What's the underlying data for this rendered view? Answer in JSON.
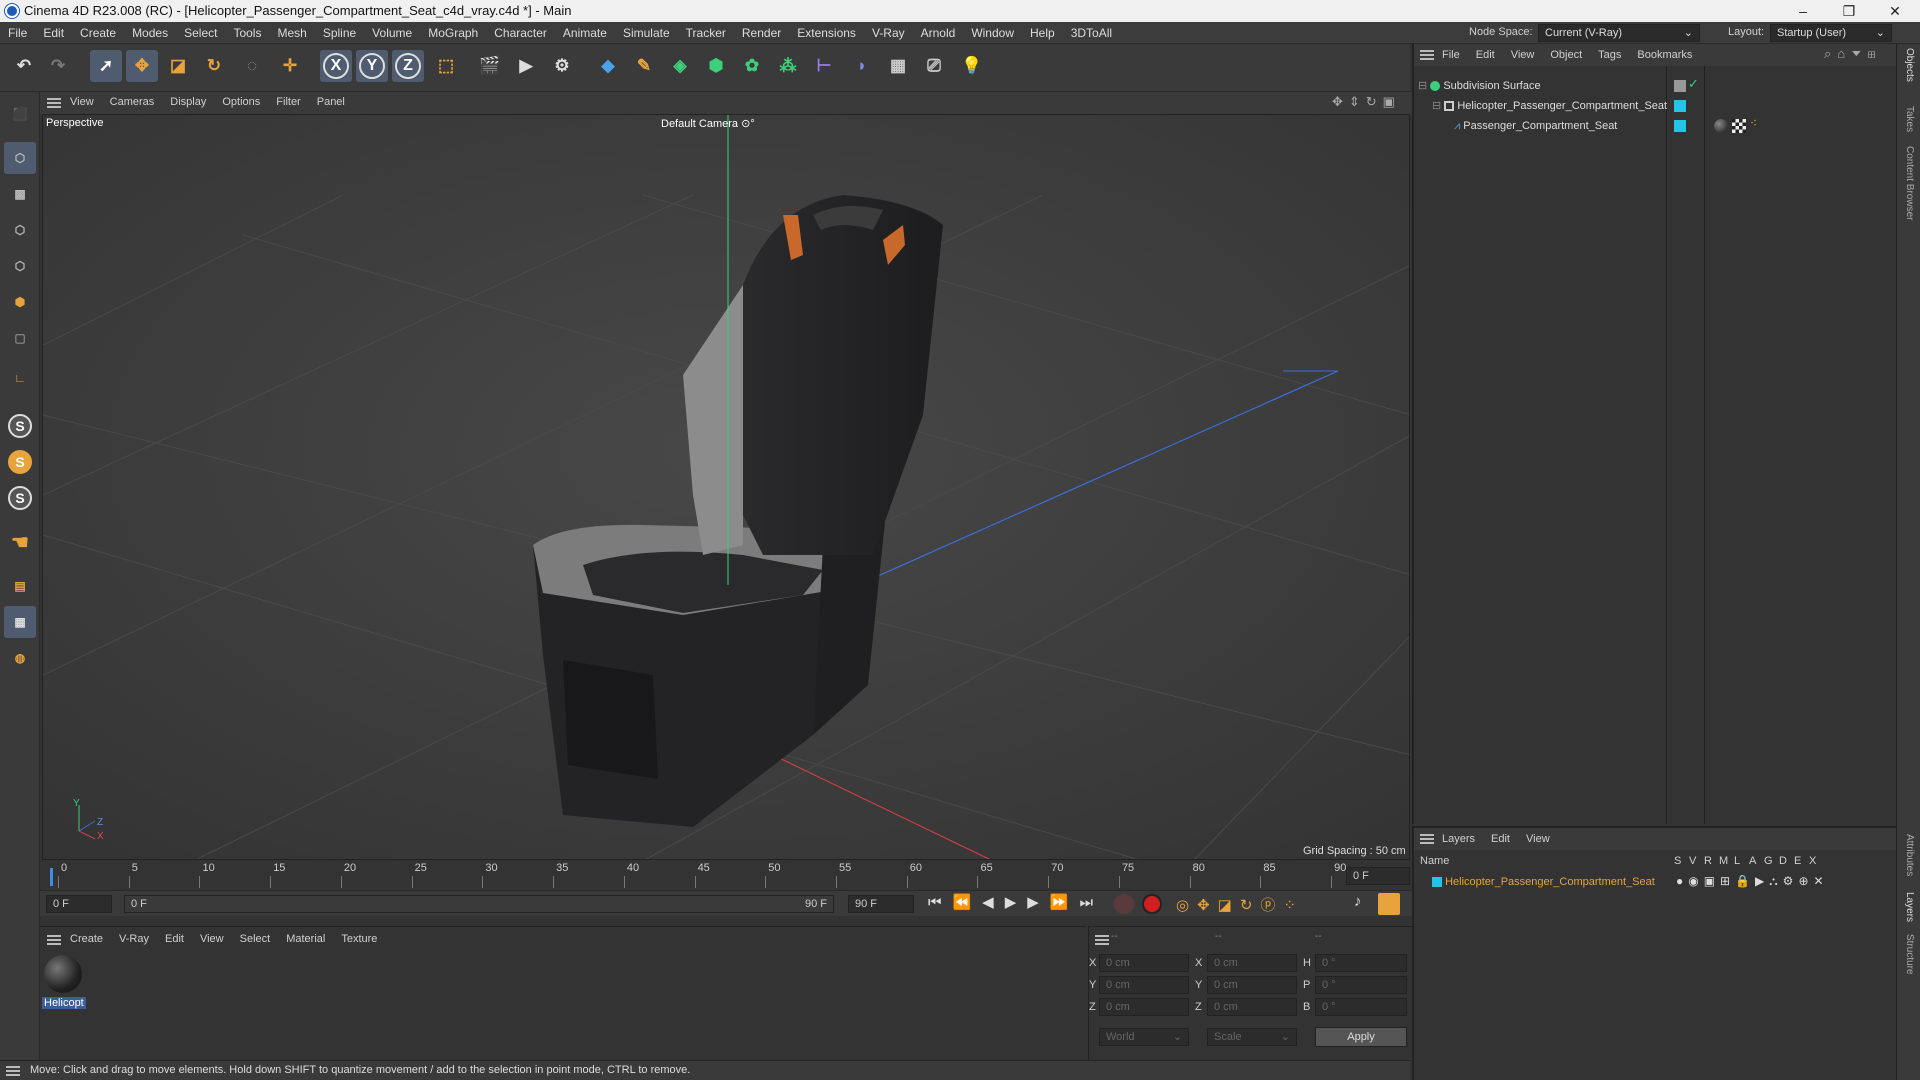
{
  "window": {
    "title": "Cinema 4D R23.008 (RC) - [Helicopter_Passenger_Compartment_Seat_c4d_vray.c4d *] - Main",
    "minimize": "–",
    "maximize": "❐",
    "close": "✕"
  },
  "menubar": {
    "items": [
      "File",
      "Edit",
      "Create",
      "Modes",
      "Select",
      "Tools",
      "Mesh",
      "Spline",
      "Volume",
      "MoGraph",
      "Character",
      "Animate",
      "Simulate",
      "Tracker",
      "Render",
      "Extensions",
      "V-Ray",
      "Arnold",
      "Window",
      "Help",
      "3DToAll"
    ],
    "node_space_label": "Node Space:",
    "node_space_value": "Current (V-Ray)",
    "layout_label": "Layout:",
    "layout_value": "Startup (User)"
  },
  "viewport": {
    "menu": [
      "View",
      "Cameras",
      "Display",
      "Options",
      "Filter",
      "Panel"
    ],
    "label": "Perspective",
    "camera": "Default Camera",
    "grid_spacing": "Grid Spacing : 50 cm",
    "axis_y": "Y",
    "axis_z": "Z",
    "axis_x": "X"
  },
  "timeline": {
    "ticks": [
      "0",
      "5",
      "10",
      "15",
      "20",
      "25",
      "30",
      "35",
      "40",
      "45",
      "50",
      "55",
      "60",
      "65",
      "70",
      "75",
      "80",
      "85",
      "90"
    ],
    "current_frame": "0 F",
    "start_field": "0 F",
    "range_start": "0 F",
    "range_end": "90 F",
    "end_field": "90 F"
  },
  "material_manager": {
    "menu": [
      "Create",
      "V-Ray",
      "Edit",
      "View",
      "Select",
      "Material",
      "Texture"
    ],
    "material_name": "Helicopt"
  },
  "coordinates": {
    "headers": [
      "--",
      "--",
      "--"
    ],
    "pos_labels": [
      "X",
      "Y",
      "Z"
    ],
    "size_labels": [
      "X",
      "Y",
      "Z"
    ],
    "rot_labels": [
      "H",
      "P",
      "B"
    ],
    "pos_values": [
      "0 cm",
      "0 cm",
      "0 cm"
    ],
    "size_values": [
      "0 cm",
      "0 cm",
      "0 cm"
    ],
    "rot_values": [
      "0 °",
      "0 °",
      "0 °"
    ],
    "world": "World",
    "scale": "Scale",
    "apply": "Apply"
  },
  "status": {
    "text": "Move: Click and drag to move elements. Hold down SHIFT to quantize movement / add to the selection in point mode, CTRL to remove."
  },
  "object_manager": {
    "menu": [
      "File",
      "Edit",
      "View",
      "Object",
      "Tags",
      "Bookmarks"
    ],
    "objects": [
      {
        "name": "Subdivision Surface",
        "indent": 0
      },
      {
        "name": "Helicopter_Passenger_Compartment_Seat",
        "indent": 1
      },
      {
        "name": "Passenger_Compartment_Seat",
        "indent": 2
      }
    ]
  },
  "layer_manager": {
    "menu": [
      "Layers",
      "Edit",
      "View"
    ],
    "name_header": "Name",
    "col_headers": [
      "S",
      "V",
      "R",
      "M",
      "L",
      "A",
      "G",
      "D",
      "E",
      "X"
    ],
    "layer_name": "Helicopter_Passenger_Compartment_Seat"
  },
  "right_strip": {
    "tabs": [
      "Objects",
      "Takes",
      "Content Browser",
      "Attributes",
      "Layers",
      "Structure"
    ]
  },
  "colors": {
    "accent_cyan": "#22c4e8",
    "layer_orange": "#e8a33c",
    "seat_orange": "#c8682a"
  }
}
